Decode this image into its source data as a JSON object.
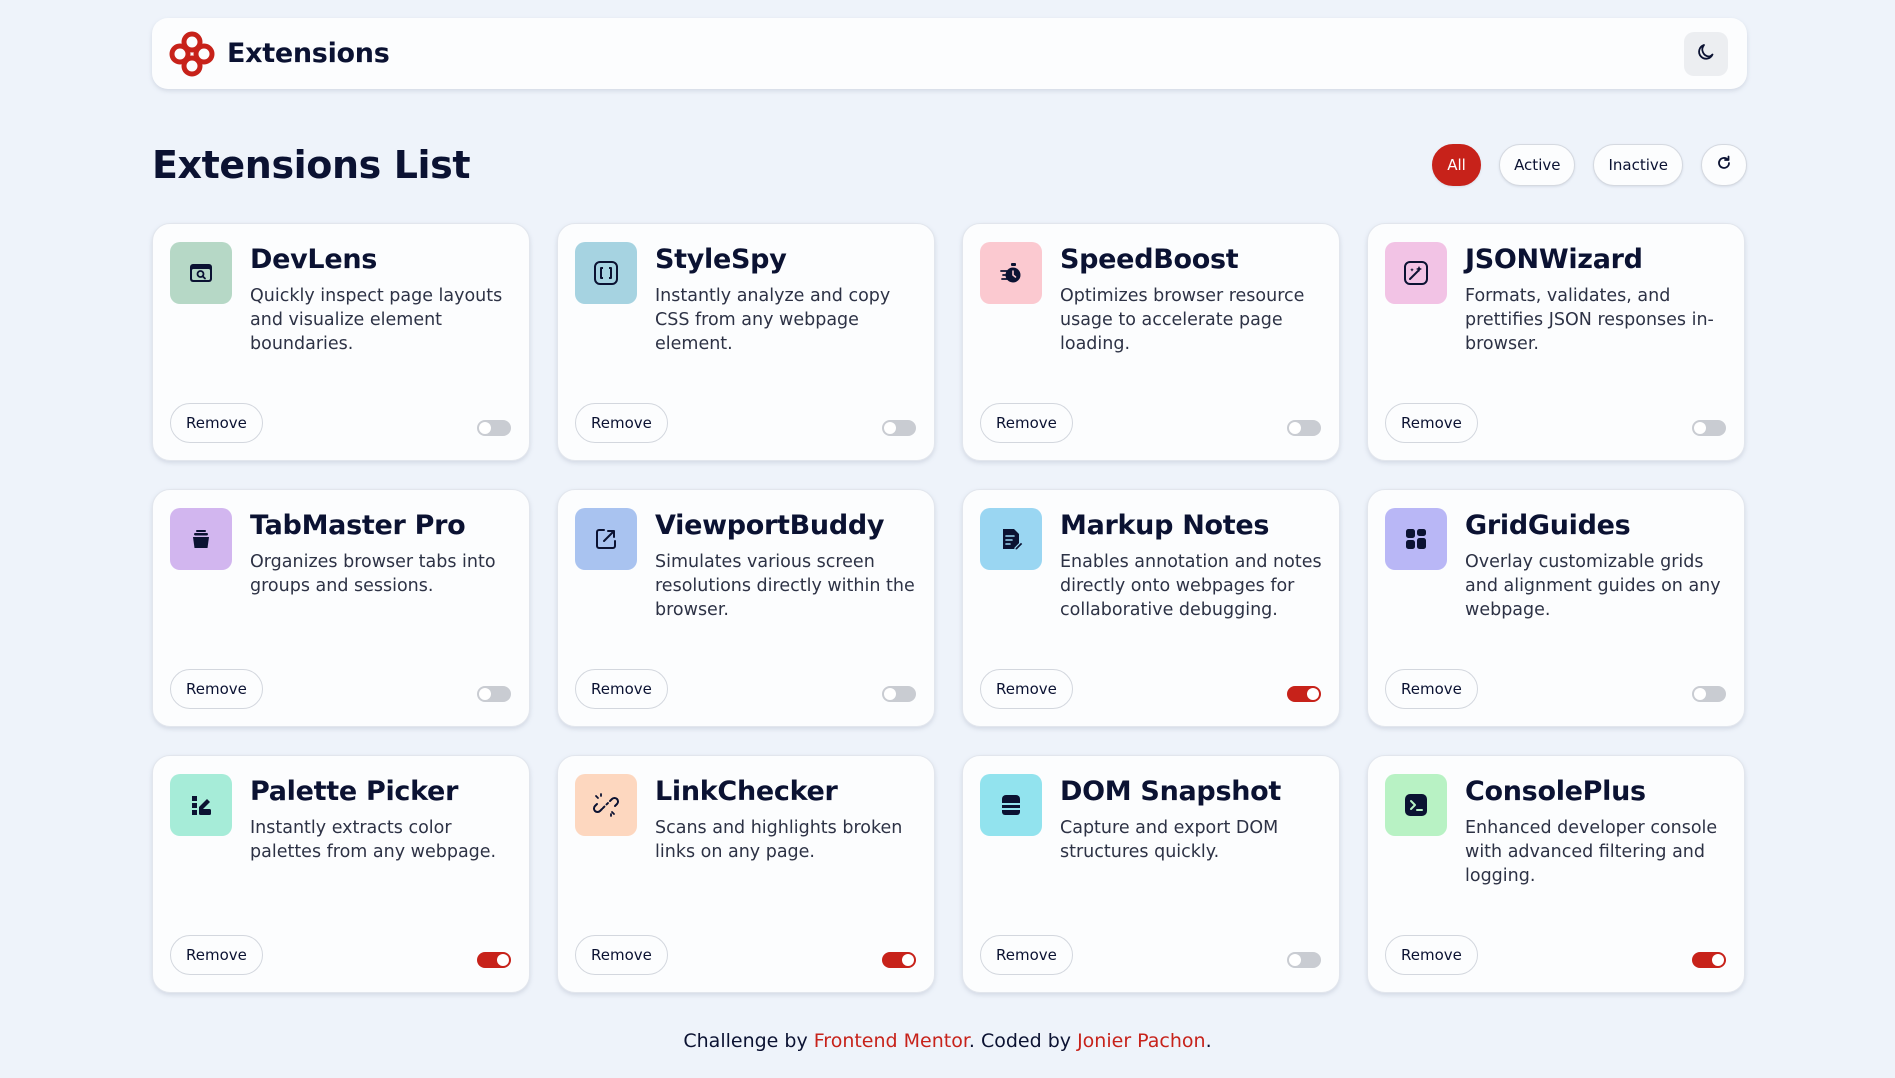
{
  "header": {
    "brand": "Extensions",
    "logo_icon": "extensions-logo-icon",
    "theme_icon": "moon-icon"
  },
  "page": {
    "title": "Extensions List"
  },
  "filters": {
    "all": "All",
    "active": "Active",
    "inactive": "Inactive",
    "refresh_icon": "refresh-icon",
    "selected": "All"
  },
  "colors": {
    "accent": "#c7221a",
    "background": "#eef3fa",
    "card": "#fcfdfe",
    "text": "#0b1232"
  },
  "extensions": [
    {
      "name": "DevLens",
      "description": "Quickly inspect page layouts and visualize element boundaries.",
      "remove": "Remove",
      "active": false,
      "icon": "inspect-window-icon",
      "icon_bg": "#b6d8c6"
    },
    {
      "name": "StyleSpy",
      "description": "Instantly analyze and copy CSS from any webpage element.",
      "remove": "Remove",
      "active": false,
      "icon": "css-brackets-icon",
      "icon_bg": "#a6d3e1"
    },
    {
      "name": "SpeedBoost",
      "description": "Optimizes browser resource usage to accelerate page loading.",
      "remove": "Remove",
      "active": false,
      "icon": "speed-stopwatch-icon",
      "icon_bg": "#fbc9d0"
    },
    {
      "name": "JSONWizard",
      "description": "Formats, validates, and prettifies JSON responses in-browser.",
      "remove": "Remove",
      "active": false,
      "icon": "json-wand-icon",
      "icon_bg": "#f2c3e5"
    },
    {
      "name": "TabMaster Pro",
      "description": "Organizes browser tabs into groups and sessions.",
      "remove": "Remove",
      "active": false,
      "icon": "tab-stack-icon",
      "icon_bg": "#d2b6ef"
    },
    {
      "name": "ViewportBuddy",
      "description": "Simulates various screen resolutions directly within the browser.",
      "remove": "Remove",
      "active": false,
      "icon": "viewport-resize-icon",
      "icon_bg": "#a9c3f0"
    },
    {
      "name": "Markup Notes",
      "description": "Enables annotation and notes directly onto webpages for collaborative debugging.",
      "remove": "Remove",
      "active": true,
      "icon": "note-pencil-icon",
      "icon_bg": "#9ad6f2"
    },
    {
      "name": "GridGuides",
      "description": "Overlay customizable grids and alignment guides on any webpage.",
      "remove": "Remove",
      "active": false,
      "icon": "grid-blocks-icon",
      "icon_bg": "#b9b7f6"
    },
    {
      "name": "Palette Picker",
      "description": "Instantly extracts color palettes from any webpage.",
      "remove": "Remove",
      "active": true,
      "icon": "palette-swatch-icon",
      "icon_bg": "#a6ecd8"
    },
    {
      "name": "LinkChecker",
      "description": "Scans and highlights broken links on any page.",
      "remove": "Remove",
      "active": true,
      "icon": "broken-link-icon",
      "icon_bg": "#fdd7bf"
    },
    {
      "name": "DOM Snapshot",
      "description": "Capture and export DOM structures quickly.",
      "remove": "Remove",
      "active": false,
      "icon": "dom-layers-icon",
      "icon_bg": "#92e3ee"
    },
    {
      "name": "ConsolePlus",
      "description": "Enhanced developer console with advanced filtering and logging.",
      "remove": "Remove",
      "active": true,
      "icon": "terminal-icon",
      "icon_bg": "#b8f2c4"
    }
  ],
  "footer": {
    "prefix": "Challenge by ",
    "link1": "Frontend Mentor",
    "middle": ". Coded by ",
    "link2": "Jonier Pachon",
    "suffix": "."
  }
}
